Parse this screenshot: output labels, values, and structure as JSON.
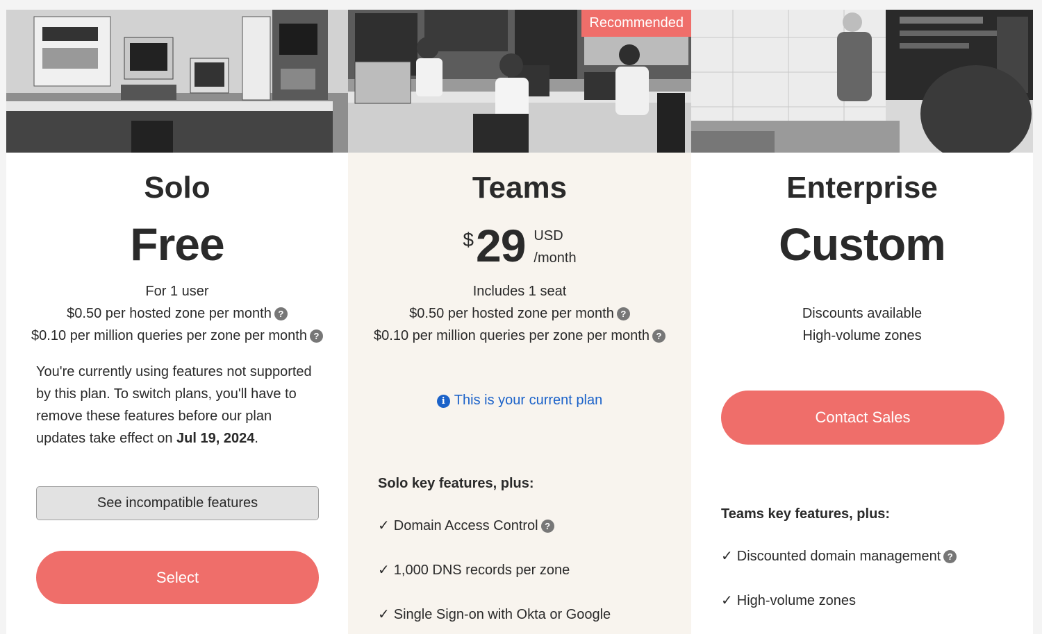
{
  "plans": {
    "solo": {
      "name": "Solo",
      "price": "Free",
      "lines": [
        "For 1 user",
        "$0.50 per hosted zone per month",
        "$0.10 per million queries per zone per month"
      ],
      "warning_text": "You're currently using features not supported by this plan. To switch plans, you'll have to remove these features before our plan updates take effect on ",
      "warning_date": "Jul 19, 2024",
      "warning_end": ".",
      "incompatible_label": "See incompatible features",
      "select_label": "Select"
    },
    "teams": {
      "badge": "Recommended",
      "name": "Teams",
      "currency": "$",
      "amount": "29",
      "unit_currency": "USD",
      "unit_period": "/month",
      "lines": [
        "Includes 1 seat",
        "$0.50 per hosted zone per month",
        "$0.10 per million queries per zone per month"
      ],
      "current_plan": "This is your current plan",
      "features_heading": "Solo key features, plus:",
      "features": [
        "Domain Access Control",
        "1,000 DNS records per zone",
        "Single Sign-on with Okta or Google"
      ]
    },
    "enterprise": {
      "name": "Enterprise",
      "price": "Custom",
      "lines": [
        "Discounts available",
        "High-volume zones"
      ],
      "contact_label": "Contact Sales",
      "features_heading": "Teams key features, plus:",
      "features": [
        "Discounted domain management",
        "High-volume zones"
      ]
    }
  },
  "icons": {
    "help": "?",
    "info": "i",
    "check": "✓"
  },
  "colors": {
    "accent": "#ef6e6a",
    "link": "#1b62c9",
    "teams_bg": "#f8f4ee"
  }
}
